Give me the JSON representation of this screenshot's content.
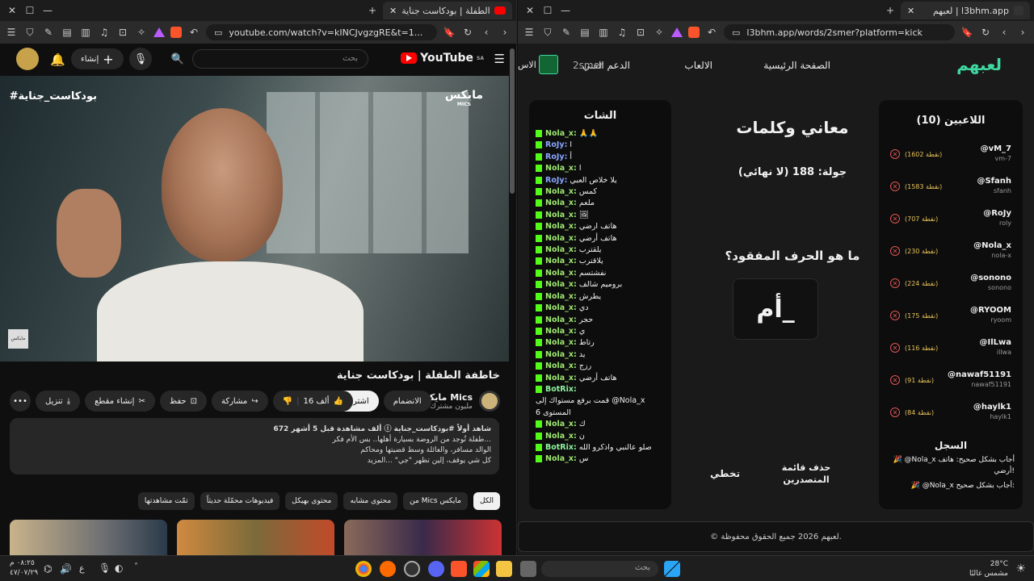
{
  "left_window": {
    "tab_title": "خاطفة الطفلة | بودكاست جناية",
    "url": "youtube.com/watch?v=kINCJvgzgRE&t=1...",
    "youtube": {
      "logo": "YouTube",
      "region": "SA",
      "search_placeholder": "بحث",
      "create_label": "إنشاء",
      "video_overlay_tag": "#بودكاست_جناية",
      "video_overlay_logo": "مايكس",
      "video_overlay_logo_sub": "MICS",
      "video_mini_logo": "مايكس",
      "video_title": "خاطفة الطفلة | بودكاست جناية",
      "channel_name": "مايكس Mics",
      "subscribers": "1.5 مليون مشترك",
      "join_label": "الانضمام",
      "subscribe_label": "اشتراك",
      "likes": "16 ألف",
      "share_label": "مشاركة",
      "save_label": "حفظ",
      "clip_label": "إنشاء مقطع",
      "download_label": "تنزيل",
      "description_lines": [
        "672 ألف مشاهدة  قبل 5 أشهر  ⓘ شاهد أولاً #بودكاست_جناية",
        "طفلة تُوجد من الروضة بسيارة أهلها.. بس الأم فكر...",
        "الوالد مسافر، والعائلة وسط قضيتها ومحاكم",
        "كل شي يوقف، إلين تظهر \"جي\" ...المزيد"
      ],
      "chips": [
        "الكل",
        "من Mics مايكس",
        "محتوى مشابه",
        "محتوى بهيكل",
        "فيديوهات محمّلة حديثاً",
        "تمّت مشاهدتها"
      ]
    }
  },
  "right_window": {
    "tab_title": "لعبهم | l3bhm.app",
    "url": "l3bhm.app/words/2smer?platform=kick",
    "brand": "لعبهم",
    "nav": [
      "الصفحة الرئيسية",
      "الالعاب",
      "الدعم الفني",
      "الاس"
    ],
    "nav_user": "2smer",
    "players_title": "اللاعبين (10)",
    "players": [
      {
        "name": "@vM_7",
        "handle": "vm-7",
        "points": "(1602 نقطة)"
      },
      {
        "name": "@Sfanh",
        "handle": "sfanh",
        "points": "(1583 نقطة)"
      },
      {
        "name": "@RoJy",
        "handle": "roly",
        "points": "(707 نقطة)"
      },
      {
        "name": "@Nola_x",
        "handle": "nola-x",
        "points": "(230 نقطة)"
      },
      {
        "name": "@sonono",
        "handle": "sonono",
        "points": "(224 نقطة)"
      },
      {
        "name": "@RYOOM",
        "handle": "ryoom",
        "points": "(175 نقطة)"
      },
      {
        "name": "@IlLwa",
        "handle": "illwa",
        "points": "(116 نقطة)"
      },
      {
        "name": "@nawaf51191",
        "handle": "nawaf51191",
        "points": "(91 نقطة)"
      },
      {
        "name": "@haylk1",
        "handle": "haylk1",
        "points": "(84 نقطة)"
      }
    ],
    "log_title": "السجل",
    "log_lines": [
      "🎉 @Nola_x أجاب بشكل صحيح: هاتف أرضي!",
      "🎉 @Nola_x أجاب بشكل صحيح:"
    ],
    "game_title": "معاني وكلمات",
    "round": "جولة: 188 (لا نهائي)",
    "question": "ما هو الحرف المفقود؟",
    "puzzle": "أم_",
    "delete_leaderboard": "حذف قائمة المتصدرين",
    "skip": "تخطي",
    "chat_title": "الشات",
    "chat": [
      {
        "user": "Nola_x:",
        "msg": "🙏🙏",
        "c": "g"
      },
      {
        "user": "RoJy:",
        "msg": "ا",
        "c": "r"
      },
      {
        "user": "RoJy:",
        "msg": "أ",
        "c": "r"
      },
      {
        "user": "Nola_x:",
        "msg": "ا",
        "c": "g"
      },
      {
        "user": "RoJy:",
        "msg": "يلا خلاص العبي",
        "c": "r"
      },
      {
        "user": "Nola_x:",
        "msg": "كمس",
        "c": "g"
      },
      {
        "user": "Nola_x:",
        "msg": "ملعم",
        "c": "g"
      },
      {
        "user": "Nola_x:",
        "msg": "🖼",
        "c": "g"
      },
      {
        "user": "Nola_x:",
        "msg": "هاتف ارضي",
        "c": "g"
      },
      {
        "user": "Nola_x:",
        "msg": "هاتف أرضي",
        "c": "g"
      },
      {
        "user": "Nola_x:",
        "msg": "يلقترب",
        "c": "g"
      },
      {
        "user": "Nola_x:",
        "msg": "يلاقترب",
        "c": "g"
      },
      {
        "user": "Nola_x:",
        "msg": "نفشتسم",
        "c": "g"
      },
      {
        "user": "Nola_x:",
        "msg": "بروميم شالف",
        "c": "g"
      },
      {
        "user": "Nola_x:",
        "msg": "يطرش",
        "c": "g"
      },
      {
        "user": "Nola_x:",
        "msg": "دي",
        "c": "g"
      },
      {
        "user": "Nola_x:",
        "msg": "حجر",
        "c": "g"
      },
      {
        "user": "Nola_x:",
        "msg": "ي",
        "c": "g"
      },
      {
        "user": "Nola_x:",
        "msg": "رتاط",
        "c": "g"
      },
      {
        "user": "Nola_x:",
        "msg": "يد",
        "c": "g"
      },
      {
        "user": "Nola_x:",
        "msg": "رزج",
        "c": "g"
      },
      {
        "user": "Nola_x:",
        "msg": "هاتف أرضي",
        "c": "g"
      },
      {
        "user": "BotRix:",
        "msg": "",
        "c": "b"
      },
      {
        "user": "",
        "msg": "قمت برفع مستواك إلى @Nola_x",
        "c": "g"
      },
      {
        "user": "",
        "msg": "المستوى 6",
        "c": "g"
      },
      {
        "user": "Nola_x:",
        "msg": "ك",
        "c": "g"
      },
      {
        "user": "Nola_x:",
        "msg": "ن",
        "c": "g"
      },
      {
        "user": "BotRix:",
        "msg": "صلو عالنبي واذكرو الله",
        "c": "b"
      },
      {
        "user": "Nola_x:",
        "msg": "س",
        "c": "g"
      }
    ],
    "footer": "© لعبهم 2026 جميع الحقوق محفوظة."
  },
  "taskbar": {
    "search_placeholder": "بحث",
    "weather_temp": "28°C",
    "weather_desc": "مشمس غالبًا",
    "time": "٠٨:٢٥ م",
    "date": "٤٧/٠٧/٢٩",
    "lang": "ع"
  }
}
